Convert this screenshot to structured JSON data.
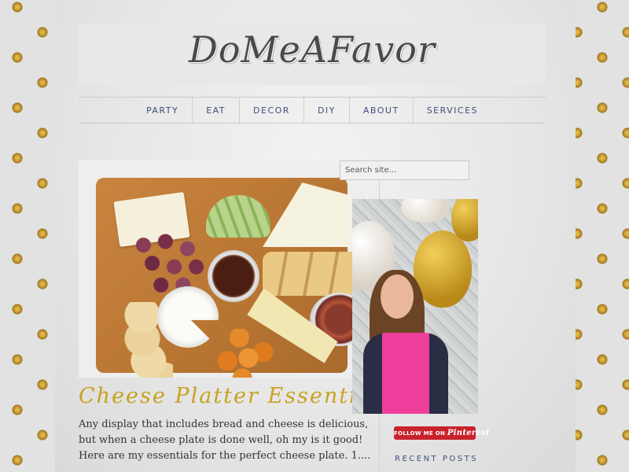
{
  "site": {
    "logo": "DoMeAFavor"
  },
  "nav": {
    "items": [
      {
        "label": "PARTY"
      },
      {
        "label": "EAT"
      },
      {
        "label": "DECOR"
      },
      {
        "label": "DIY"
      },
      {
        "label": "ABOUT"
      },
      {
        "label": "SERVICES"
      }
    ]
  },
  "post": {
    "title": "Cheese Platter Essentials",
    "excerpt": "Any display that includes bread and cheese is delicious, but when a cheese plate is done well, oh my is it good! Here are my essentials for the perfect cheese plate. 1...."
  },
  "sidebar": {
    "search_placeholder": "Search site...",
    "pinterest": {
      "prefix": "FOLLOW ME ON",
      "brand": "Pinterest"
    },
    "recent_posts_heading": "RECENT POSTS"
  },
  "colors": {
    "accent_gold": "#c9a21f",
    "nav_text": "#3f4f78",
    "pinterest_red": "#c8232c"
  }
}
